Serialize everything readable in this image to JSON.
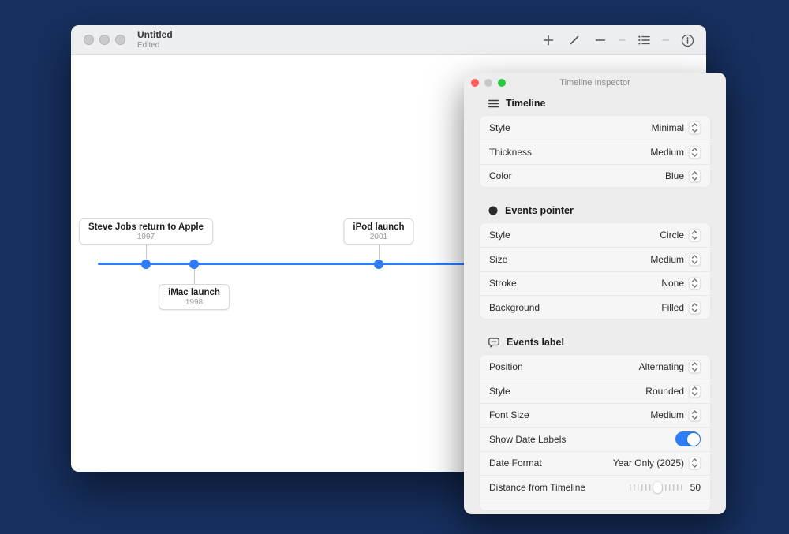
{
  "desktop_bg": "#17305f",
  "window": {
    "title": "Untitled",
    "subtitle": "Edited"
  },
  "toolbar": {
    "buttons": [
      "add-event",
      "edit",
      "remove-event",
      "list-view",
      "info"
    ]
  },
  "timeline": {
    "accent_color": "#2e7cf6",
    "events": [
      {
        "title": "Steve Jobs return to Apple",
        "year": "1997",
        "position": "above"
      },
      {
        "title": "iMac launch",
        "year": "1998",
        "position": "below"
      },
      {
        "title": "iPod launch",
        "year": "2001",
        "position": "above"
      }
    ]
  },
  "inspector": {
    "title": "Timeline Inspector",
    "sections": [
      {
        "title": "Timeline",
        "icon": "hamburger-icon",
        "rows": [
          {
            "label": "Style",
            "value": "Minimal"
          },
          {
            "label": "Thickness",
            "value": "Medium"
          },
          {
            "label": "Color",
            "value": "Blue"
          }
        ]
      },
      {
        "title": "Events pointer",
        "icon": "filled-circle-icon",
        "rows": [
          {
            "label": "Style",
            "value": "Circle"
          },
          {
            "label": "Size",
            "value": "Medium"
          },
          {
            "label": "Stroke",
            "value": "None"
          },
          {
            "label": "Background",
            "value": "Filled"
          }
        ]
      },
      {
        "title": "Events label",
        "icon": "speech-bubble-icon",
        "rows": [
          {
            "label": "Position",
            "value": "Alternating"
          },
          {
            "label": "Style",
            "value": "Rounded"
          },
          {
            "label": "Font Size",
            "value": "Medium"
          },
          {
            "label": "Show Date Labels",
            "value": "on",
            "control": "toggle"
          },
          {
            "label": "Date Format",
            "value": "Year Only (2025)"
          },
          {
            "label": "Distance from Timeline",
            "value": "50",
            "control": "slider"
          }
        ]
      }
    ]
  }
}
